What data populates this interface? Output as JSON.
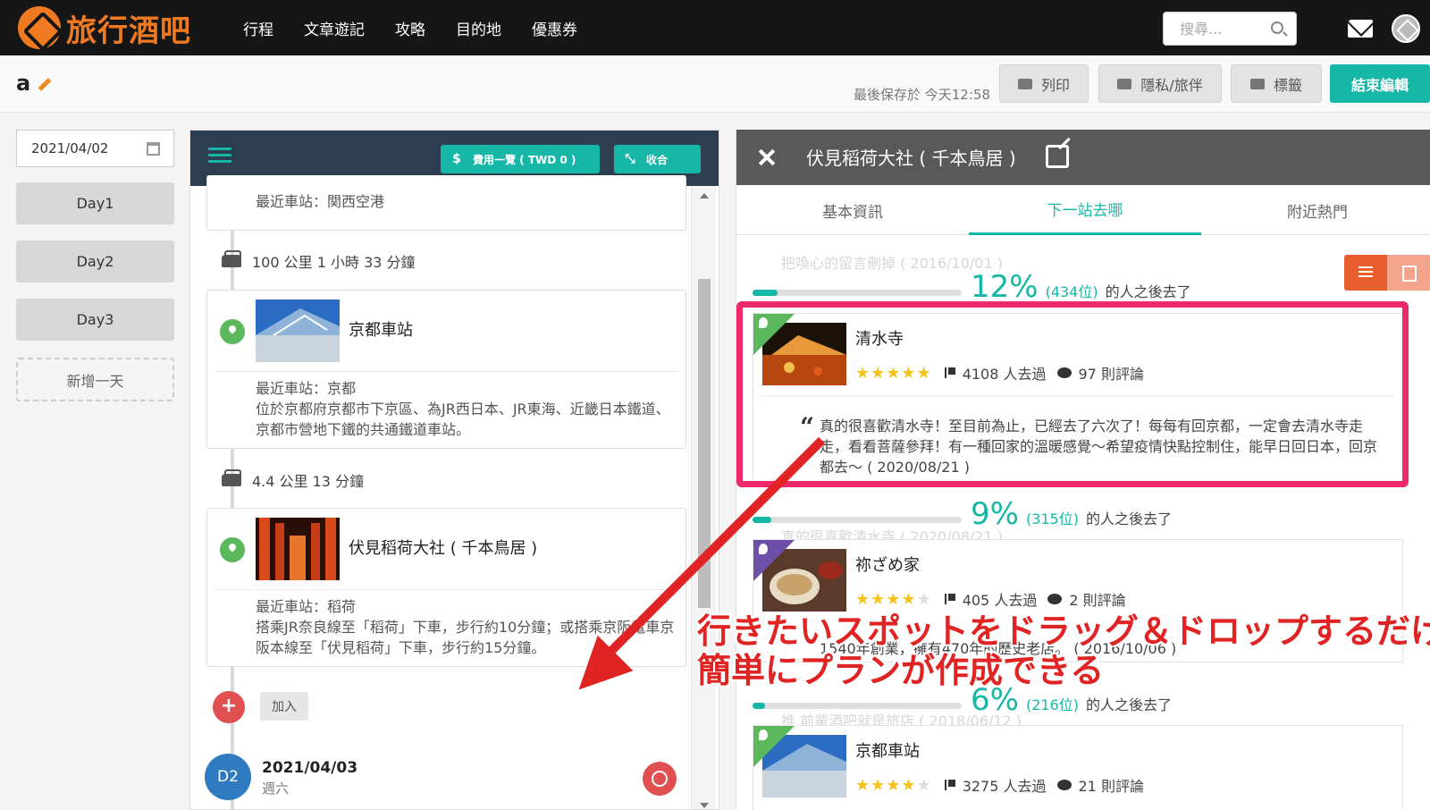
{
  "nav": {
    "logo_text": "旅行酒吧",
    "links": [
      "行程",
      "文章遊記",
      "攻略",
      "目的地",
      "優惠券"
    ],
    "search_placeholder": "搜尋...",
    "accent": "#f07a21"
  },
  "titlebar": {
    "trip_name": "a",
    "saved_text": "最後保存於 今天12:58",
    "buttons": {
      "print": "列印",
      "privacy": "隱私/旅伴",
      "tags": "標籤",
      "finish": "結束編輯"
    }
  },
  "left": {
    "date": "2021/04/02",
    "days": [
      "Day1",
      "Day2",
      "Day3"
    ],
    "add_day": "新增一天"
  },
  "middle": {
    "expense_button": "費用一覽 ( TWD 0 )",
    "collapse_button": "收合",
    "top_station": "最近車站：関西空港",
    "travel1": "100 公里 1 小時 33 分鐘",
    "card1": {
      "title": "京都車站",
      "station": "最近車站：京都",
      "desc": "位於京都府京都市下京區、為JR西日本、JR東海、近畿日本鐵道、京都市營地下鐵的共通鐵道車站。"
    },
    "travel2": "4.4 公里 13 分鐘",
    "card2": {
      "title": "伏見稻荷大社 ( 千本鳥居 )",
      "station": "最近車站：稻荷",
      "desc": "搭乘JR奈良線至「稻荷」下車，步行約10分鐘；或搭乘京阪電車京阪本線至「伏見稻荷」下車，步行約15分鐘。"
    },
    "add_label": "加入",
    "next_day": {
      "badge": "D2",
      "date": "2021/04/03",
      "weekday": "週六"
    }
  },
  "right": {
    "title": "伏見稻荷大社 ( 千本鳥居 )",
    "tabs": [
      "基本資訊",
      "下一站去哪",
      "附近熱門"
    ],
    "ghost_top": "把喚心的留言刪掉 ( 2016/10/01 )",
    "ghost_mid": "真的很喜歡清水寺 ( 2020/08/21 )",
    "ghost_bot": "推 前輩酒吧就是旅店 ( 2018/06/12 )",
    "groups": [
      {
        "percent": "12%",
        "percent_value": 12,
        "count": "(434位)",
        "suffix": "的人之後去了",
        "spot": {
          "name": "清水寺",
          "stars": 5,
          "visits": "4108 人去過",
          "reviews": "97 則評論",
          "review": "真的很喜歡清水寺！至目前為止，已經去了六次了！每每有回京都，一定會去清水寺走走，看看菩薩參拜！有一種回家的溫暖感覺～希望疫情快點控制住，能早日回日本，回京都去～ ( 2020/08/21 )"
        }
      },
      {
        "percent": "9%",
        "percent_value": 9,
        "count": "(315位)",
        "suffix": "的人之後去了",
        "spot": {
          "name": "祢ざめ家",
          "stars": 4,
          "visits": "405 人去過",
          "reviews": "2 則評論",
          "review": "1540年創業，擁有470年的歷史老店。 ( 2016/10/06 )"
        }
      },
      {
        "percent": "6%",
        "percent_value": 6,
        "count": "(216位)",
        "suffix": "的人之後去了",
        "spot": {
          "name": "京都車站",
          "stars": 4,
          "visits": "3275 人去過",
          "reviews": "21 則評論"
        }
      }
    ]
  },
  "annotation": {
    "line1": "行きたいスポットをドラッグ＆ドロップするだけで",
    "line2": "簡単にプランが作成できる",
    "color": "#e02323"
  },
  "colors": {
    "teal": "#16b7a6",
    "dark_header": "#2c3e50",
    "right_header": "#595959",
    "highlight": "#ec2a6b"
  }
}
